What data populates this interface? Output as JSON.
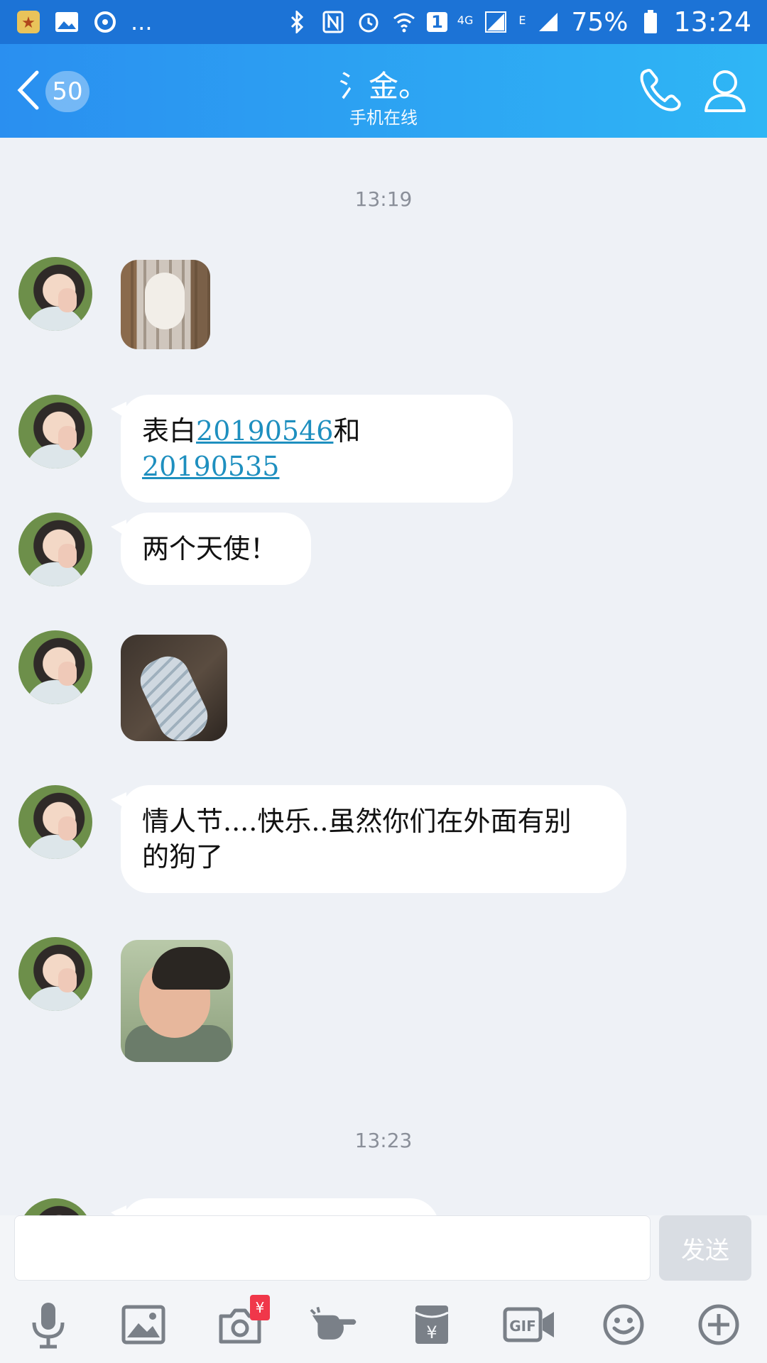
{
  "status_bar": {
    "icons_left": [
      "star-badge-icon",
      "gallery-icon",
      "sync-icon",
      "more-dots"
    ],
    "more_text": "...",
    "icons_right": [
      "bluetooth-icon",
      "nfc-icon",
      "alarm-icon",
      "wifi-icon",
      "sim1-icon",
      "4g-signal-icon",
      "e-signal-icon",
      "battery-icon"
    ],
    "sim_label": "1",
    "network_4g": "4G",
    "network_e": "E",
    "battery": "75%",
    "time": "13:24"
  },
  "header": {
    "unread_count": "50",
    "title": "氵金。",
    "subtitle": "手机在线",
    "icons": [
      "back-icon",
      "phone-icon",
      "profile-icon"
    ]
  },
  "messages": [
    {
      "type": "timestamp",
      "text": "13:19"
    },
    {
      "type": "image",
      "desc": "cat-sticker"
    },
    {
      "type": "text",
      "parts": [
        "表白",
        "20190546",
        "和",
        "20190535"
      ]
    },
    {
      "type": "text",
      "text": "两个天使！"
    },
    {
      "type": "image",
      "desc": "glove-sticker"
    },
    {
      "type": "text",
      "lines": [
        "情人节....快乐..虽然你们在外面有别",
        "的狗了"
      ]
    },
    {
      "type": "image",
      "desc": "crying-child-sticker"
    },
    {
      "type": "timestamp",
      "text": "13:23"
    }
  ],
  "composer": {
    "input_value": "",
    "send_label": "发送",
    "tools": [
      "microphone-icon",
      "picture-icon",
      "camera-icon",
      "poke-icon",
      "red-packet-icon",
      "gif-icon",
      "emoji-icon",
      "plus-icon"
    ],
    "camera_badge": "¥",
    "gif_label": "GIF"
  },
  "colors": {
    "status_bar": "#1c73d6",
    "header_from": "#2a8ff0",
    "header_to": "#2fb6f5",
    "chat_bg": "#eef1f6",
    "link": "#1e8fbf"
  }
}
